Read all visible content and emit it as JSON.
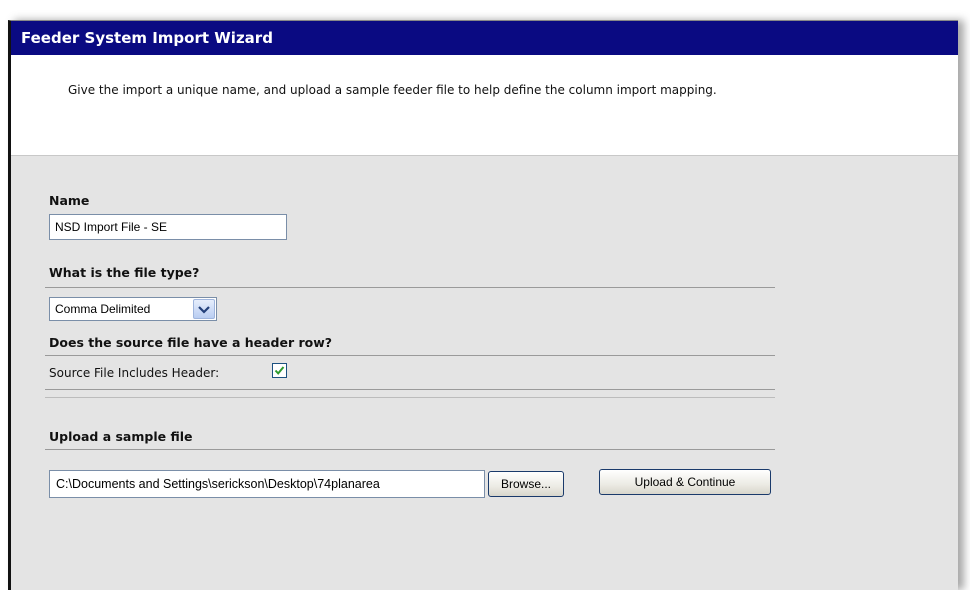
{
  "window": {
    "title": "Feeder System Import Wizard"
  },
  "intro": {
    "text": "Give the import a unique name, and upload a sample feeder file to help define the column import mapping."
  },
  "form": {
    "name": {
      "label": "Name",
      "value": "NSD Import File - SE"
    },
    "file_type": {
      "label": "What is the file type?",
      "selected": "Comma Delimited"
    },
    "header_row": {
      "label": "Does the source file have a header row?",
      "checkbox_label": "Source File Includes Header:",
      "checked": true
    },
    "upload": {
      "label": "Upload a sample file",
      "file_path": "C:\\Documents and Settings\\serickson\\Desktop\\74planarea",
      "browse_label": "Browse...",
      "submit_label": "Upload & Continue"
    }
  },
  "colors": {
    "titlebar": "#0a0a82",
    "panel": "#e4e4e4",
    "check": "#2e9a2e"
  }
}
